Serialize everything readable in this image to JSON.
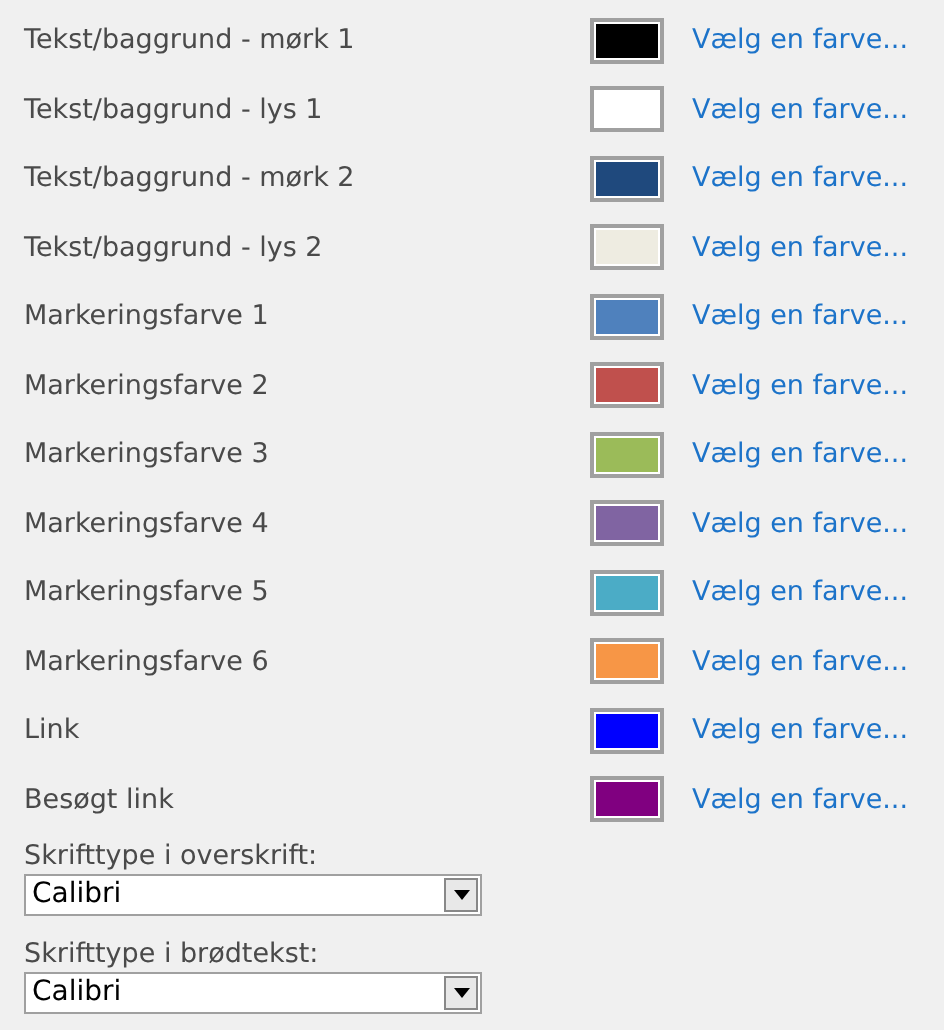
{
  "colors": [
    {
      "label": "Tekst/baggrund - mørk 1",
      "color": "#000000",
      "link": "Vælg en farve..."
    },
    {
      "label": "Tekst/baggrund - lys 1",
      "color": "#ffffff",
      "link": "Vælg en farve..."
    },
    {
      "label": "Tekst/baggrund - mørk 2",
      "color": "#1f497d",
      "link": "Vælg en farve..."
    },
    {
      "label": "Tekst/baggrund - lys 2",
      "color": "#eeece1",
      "link": "Vælg en farve..."
    },
    {
      "label": "Markeringsfarve 1",
      "color": "#4f81bd",
      "link": "Vælg en farve..."
    },
    {
      "label": "Markeringsfarve 2",
      "color": "#c0504d",
      "link": "Vælg en farve..."
    },
    {
      "label": "Markeringsfarve 3",
      "color": "#9bbb59",
      "link": "Vælg en farve..."
    },
    {
      "label": "Markeringsfarve 4",
      "color": "#8064a2",
      "link": "Vælg en farve..."
    },
    {
      "label": "Markeringsfarve 5",
      "color": "#4bacc6",
      "link": "Vælg en farve..."
    },
    {
      "label": "Markeringsfarve 6",
      "color": "#f79646",
      "link": "Vælg en farve..."
    },
    {
      "label": "Link",
      "color": "#0000ff",
      "link": "Vælg en farve..."
    },
    {
      "label": "Besøgt link",
      "color": "#800080",
      "link": "Vælg en farve..."
    }
  ],
  "fonts": [
    {
      "label": "Skrifttype i overskrift:",
      "value": "Calibri"
    },
    {
      "label": "Skrifttype i brødtekst:",
      "value": "Calibri"
    }
  ]
}
